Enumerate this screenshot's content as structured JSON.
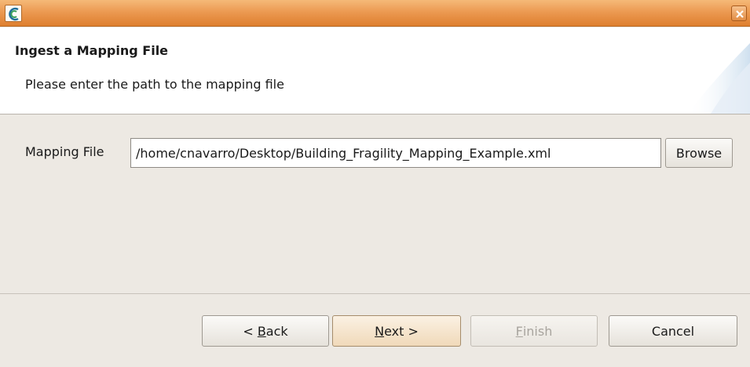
{
  "window": {
    "app_icon": "app-logo-icon",
    "close_icon": "close-icon"
  },
  "header": {
    "title": "Ingest a Mapping File",
    "description": "Please enter the path to the mapping file"
  },
  "form": {
    "mapping_file_label": "Mapping File",
    "mapping_file_value": "/home/cnavarro/Desktop/Building_Fragility_Mapping_Example.xml",
    "browse_label": "Browse"
  },
  "buttons": {
    "back": {
      "prefix": "< ",
      "mnemonic": "B",
      "rest": "ack"
    },
    "next": {
      "mnemonic": "N",
      "rest": "ext >"
    },
    "finish": {
      "mnemonic": "F",
      "rest": "inish",
      "enabled": false
    },
    "cancel": "Cancel"
  },
  "colors": {
    "titlebar": "#e48b3a",
    "dialog_bg": "#ede9e3",
    "header_bg": "#ffffff",
    "default_button": "#f0d9b9"
  }
}
